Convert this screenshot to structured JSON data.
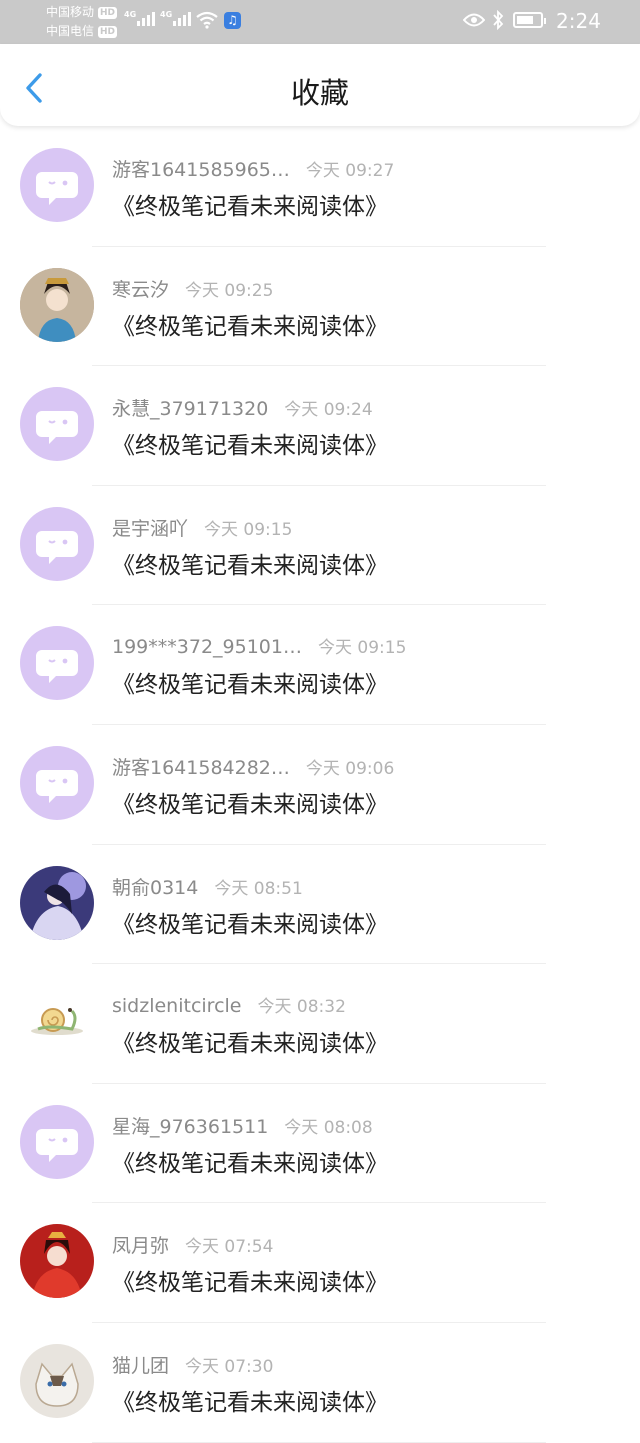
{
  "status_bar": {
    "carrier1": "中国移动",
    "carrier2": "中国电信",
    "hd_badge": "HD",
    "network_tag": "4G",
    "time": "2:24"
  },
  "header": {
    "title": "收藏"
  },
  "items": [
    {
      "name": "游客1641585965…",
      "time": "今天 09:27",
      "book": "《终极笔记看未来阅读体》",
      "avatar": "default-chat-avatar"
    },
    {
      "name": "寒云汐",
      "time": "今天 09:25",
      "book": "《终极笔记看未来阅读体》",
      "avatar": "photo-avatar"
    },
    {
      "name": "永慧_379171320",
      "time": "今天 09:24",
      "book": "《终极笔记看未来阅读体》",
      "avatar": "default-chat-avatar"
    },
    {
      "name": "是宇涵吖",
      "time": "今天 09:15",
      "book": "《终极笔记看未来阅读体》",
      "avatar": "default-chat-avatar"
    },
    {
      "name": "199***372_95101…",
      "time": "今天 09:15",
      "book": "《终极笔记看未来阅读体》",
      "avatar": "default-chat-avatar"
    },
    {
      "name": "游客1641584282…",
      "time": "今天 09:06",
      "book": "《终极笔记看未来阅读体》",
      "avatar": "default-chat-avatar"
    },
    {
      "name": "朝俞0314",
      "time": "今天 08:51",
      "book": "《终极笔记看未来阅读体》",
      "avatar": "photo-avatar"
    },
    {
      "name": "sidzlenitcircle",
      "time": "今天 08:32",
      "book": "《终极笔记看未来阅读体》",
      "avatar": "snail-avatar"
    },
    {
      "name": "星海_976361511",
      "time": "今天 08:08",
      "book": "《终极笔记看未来阅读体》",
      "avatar": "default-chat-avatar"
    },
    {
      "name": "凤月弥",
      "time": "今天 07:54",
      "book": "《终极笔记看未来阅读体》",
      "avatar": "photo-avatar"
    },
    {
      "name": "猫儿团",
      "time": "今天 07:30",
      "book": "《终极笔记看未来阅读体》",
      "avatar": "photo-avatar"
    }
  ],
  "colors": {
    "accent": "#3d9be9",
    "default_avatar_bg": "#d9c6f4",
    "status_bar_bg": "#c9c9c9"
  }
}
